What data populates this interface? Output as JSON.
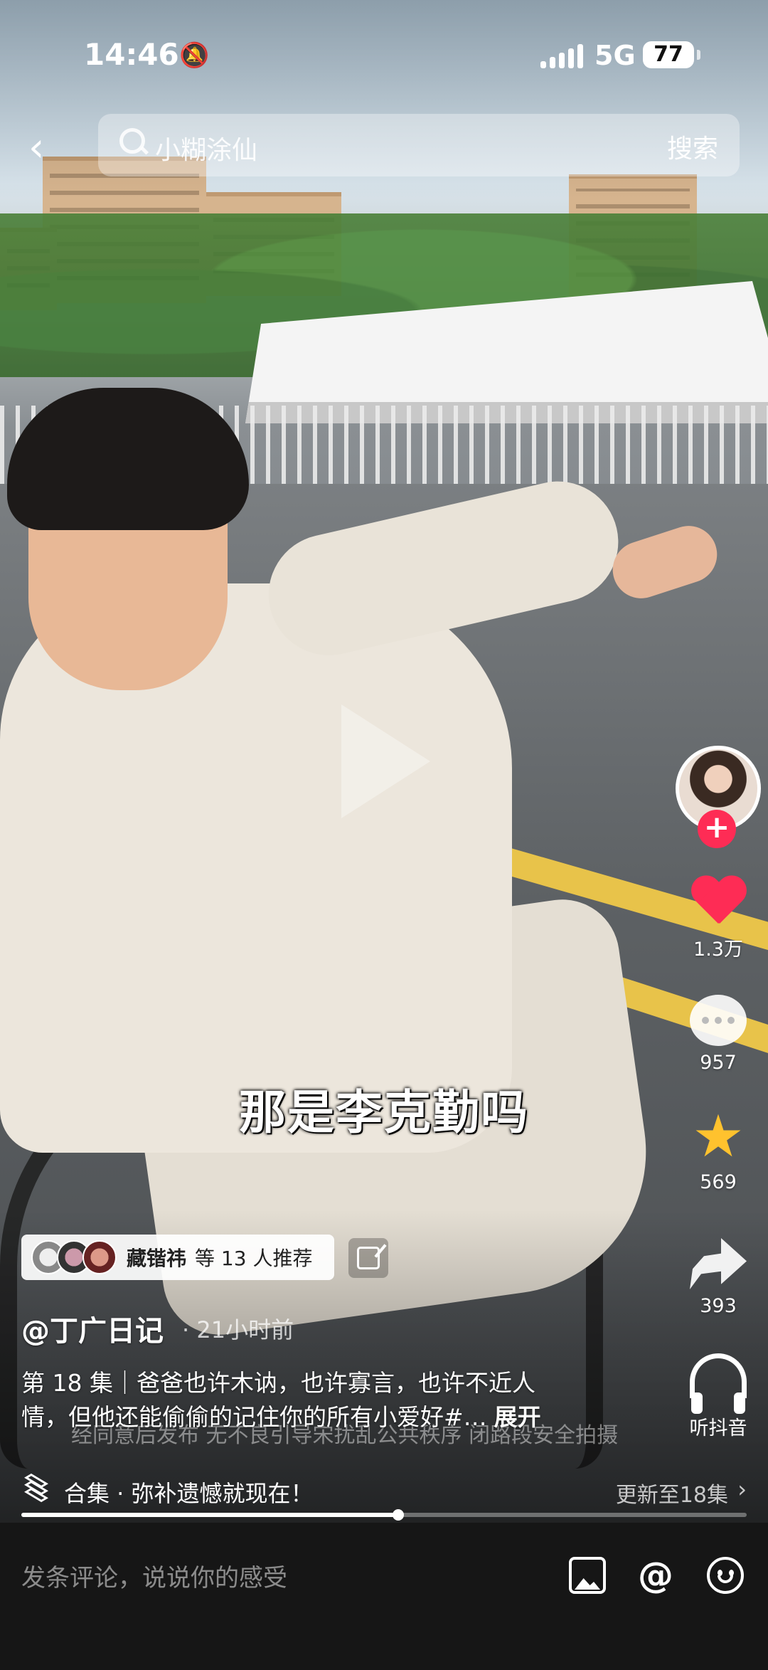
{
  "status_bar": {
    "time": "14:46",
    "network": "5G",
    "battery": "77"
  },
  "search": {
    "placeholder": "小糊涂仙",
    "button": "搜索"
  },
  "video": {
    "subtitle": "那是李克勤吗",
    "progress_fraction": 0.52
  },
  "actions": {
    "likes": "1.3万",
    "comments": "957",
    "favorites": "569",
    "shares": "393",
    "listen_label": "听抖音"
  },
  "recommend": {
    "name": "藏锴祎",
    "suffix": "等 13 人推荐"
  },
  "post": {
    "author": "@丁广日记",
    "time_ago": "· 21小时前",
    "description": "第 18 集｜爸爸也许木讷，也许寡言，也许不近人情，但他还能偷偷的记住你的所有小爱好#…",
    "expand": "展开",
    "notice": "经同意后发布 无不良引导宋扰乱公共秩序 闭路段安全拍摄"
  },
  "collection": {
    "title": "合集 · 弥补遗憾就现在！",
    "update": "更新至18集"
  },
  "comment_bar": {
    "placeholder": "发条评论，说说你的感受"
  },
  "colors": {
    "accent": "#fe2c55",
    "star": "#ffc22e"
  }
}
